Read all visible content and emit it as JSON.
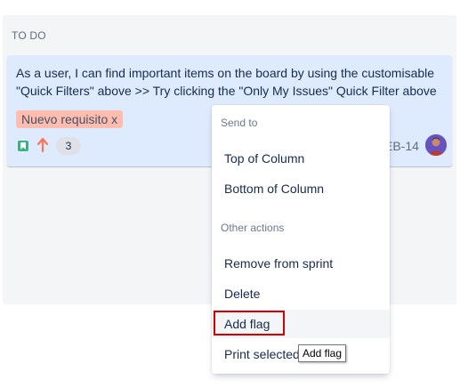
{
  "column": {
    "title": "TO DO"
  },
  "card": {
    "summary": "As a user, I can find important items on the board by using the customisable \"Quick Filters\" above >> Try clicking the \"Only My Issues\" Quick Filter above",
    "label": "Nuevo requisito x",
    "issue_type_icon": "story-icon",
    "priority_icon": "arrow-up-icon",
    "story_points": "3",
    "issue_key": "EB-14",
    "colors": {
      "card_bg": "#deebff",
      "label_bg": "#ffbdad",
      "story_green": "#36b37e",
      "priority_orange": "#ff7452"
    }
  },
  "context_menu": {
    "send_to_heading": "Send to",
    "top_of_column": "Top of Column",
    "bottom_of_column": "Bottom of Column",
    "other_actions_heading": "Other actions",
    "remove_from_sprint": "Remove from sprint",
    "delete": "Delete",
    "add_flag": "Add flag",
    "print_selected": "Print selected"
  },
  "tooltip": {
    "text": "Add flag"
  },
  "highlight_color": "#d60000"
}
